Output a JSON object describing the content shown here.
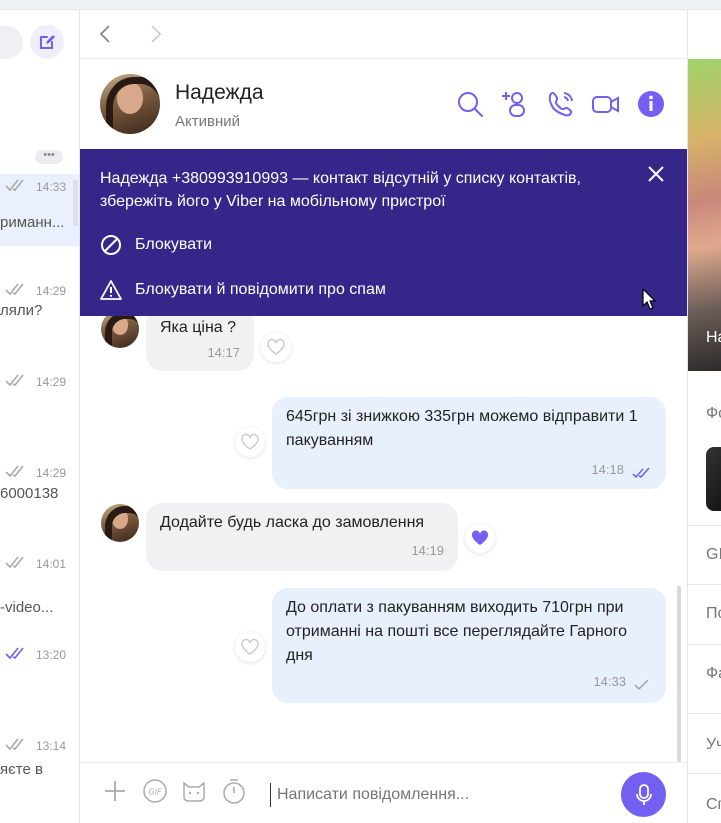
{
  "chat_list": {
    "rows": [
      {
        "time": "14:33",
        "snippet": "риманн...",
        "selected": true
      },
      {
        "time": "14:29",
        "snippet": "ляли?",
        "selected": false
      },
      {
        "time": "14:29",
        "snippet": "",
        "selected": false
      },
      {
        "time": "14:29",
        "snippet": "6000138",
        "selected": false
      },
      {
        "time": "14:01",
        "snippet": "-video...",
        "selected": false
      },
      {
        "time": "13:20",
        "snippet": "",
        "selected": false
      },
      {
        "time": "13:14",
        "snippet": "яєте в",
        "selected": false
      }
    ],
    "more_label": "•••"
  },
  "header": {
    "name": "Надежда",
    "status": "Активний"
  },
  "banner": {
    "message": "Надежда +380993910993 — контакт відсутній у списку контактів, збережіть його у Viber на мобільному пристрої",
    "block_label": "Блокувати",
    "block_report_label": "Блокувати й повідомити про спам"
  },
  "messages": [
    {
      "direction": "in",
      "text": "Яка ціна ?",
      "time": "14:17",
      "liked": false
    },
    {
      "direction": "out",
      "text": "645грн зі знижкою 335грн можемо відправити 1 пакуванням",
      "time": "14:18",
      "status": "read",
      "liked": false
    },
    {
      "direction": "in",
      "text": "Додайте будь ласка до замовлення",
      "time": "14:19",
      "liked": true
    },
    {
      "direction": "out",
      "text": "До оплати з пакуванням виходить 710грн при отриманні на пошті все переглядайте Гарного дня",
      "time": "14:33",
      "status": "delivered",
      "liked": false
    }
  ],
  "composer": {
    "placeholder": "Написати повідомлення..."
  },
  "right_panel": {
    "photo_caption": "На",
    "sections": [
      "Фо",
      "GI",
      "По",
      "Фа",
      "Уч",
      "Сп"
    ]
  },
  "colors": {
    "accent": "#7360f2",
    "banner_bg": "#37268a",
    "outgoing_bubble": "#e8f0fd",
    "incoming_bubble": "#f1f1f3"
  }
}
